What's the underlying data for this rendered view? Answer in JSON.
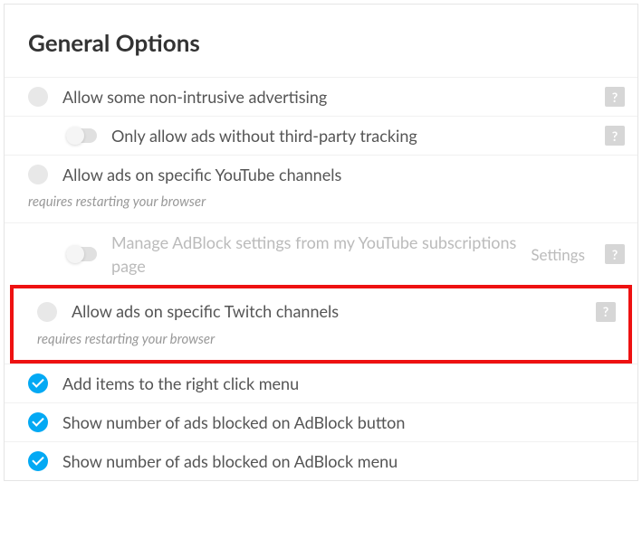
{
  "title": "General Options",
  "help_glyph": "?",
  "requires_text": "requires restarting your browser",
  "settings_link": "Settings",
  "options": {
    "non_intrusive": "Allow some non-intrusive advertising",
    "no_tracking": "Only allow ads without third-party tracking",
    "youtube": "Allow ads on specific YouTube channels",
    "youtube_sub": "Manage AdBlock settings from my YouTube subscriptions page",
    "twitch": "Allow ads on specific Twitch channels",
    "right_click": "Add items to the right click menu",
    "count_button": "Show number of ads blocked on AdBlock button",
    "count_menu": "Show number of ads blocked on AdBlock menu"
  }
}
